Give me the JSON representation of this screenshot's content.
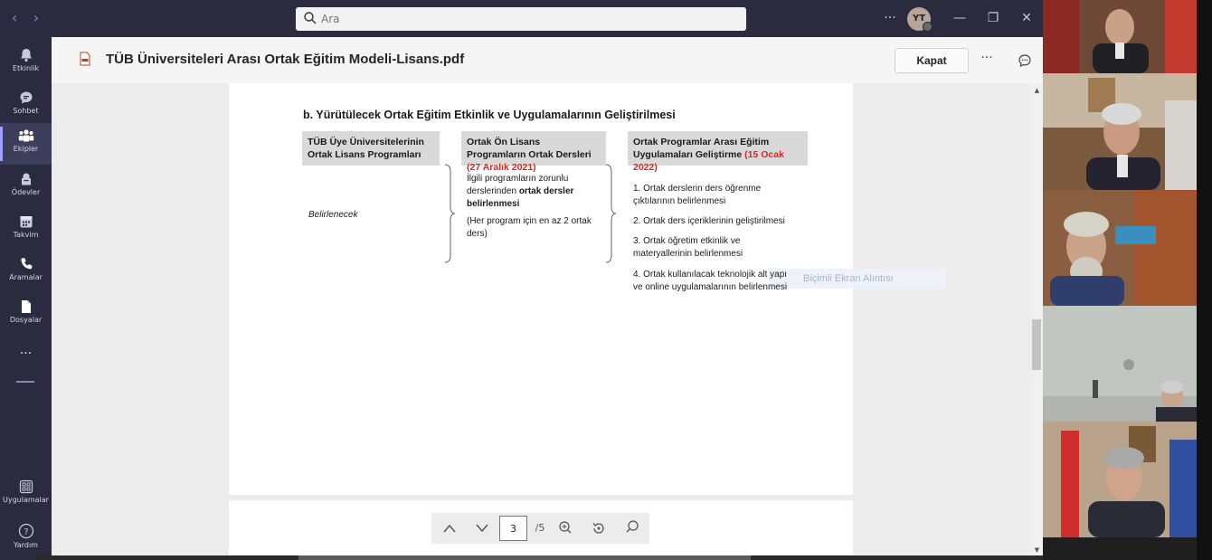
{
  "search": {
    "placeholder": "Ara"
  },
  "user": {
    "initials": "YT"
  },
  "window": {
    "more": "···",
    "minimize": "—",
    "restore": "❐",
    "close": "✕"
  },
  "nav": {
    "back": "‹",
    "forward": "›"
  },
  "rail": {
    "items": [
      {
        "label": "Etkinlik",
        "icon": "bell-icon"
      },
      {
        "label": "Sohbet",
        "icon": "chat-icon"
      },
      {
        "label": "Ekipler",
        "icon": "teams-icon"
      },
      {
        "label": "Ödevler",
        "icon": "assignments-icon"
      },
      {
        "label": "Takvim",
        "icon": "calendar-icon"
      },
      {
        "label": "Aramalar",
        "icon": "phone-icon"
      },
      {
        "label": "Dosyalar",
        "icon": "file-icon"
      }
    ],
    "more": "···",
    "apps": "Uygulamalar",
    "help": "Yardım"
  },
  "document": {
    "title": "TÜB Üniversiteleri Arası Ortak Eğitim Modeli-Lisans.pdf",
    "close_label": "Kapat",
    "more": "···"
  },
  "pdf": {
    "section_title": "b. Yürütülecek Ortak Eğitim Etkinlik ve Uygulamalarının Geliştirilmesi",
    "col1": {
      "header": "TÜB Üye Üniversitelerinin Ortak Lisans Programları",
      "body": "Belirlenecek"
    },
    "col2": {
      "header": "Ortak Ön Lisans Programların Ortak Dersleri",
      "header_date": "(27 Aralık 2021)",
      "body_prefix": "İlgili programların zorunlu derslerinden",
      "body_bold": "ortak dersler belirlenmesi",
      "note": "(Her program için en az 2 ortak ders)"
    },
    "col3": {
      "header": "Ortak Programlar Arası Eğitim Uygulamaları Geliştirme",
      "header_date": "(15 Ocak 2022)",
      "items": [
        "1. Ortak derslerin ders öğrenme çıktılarının belirlenmesi",
        "2. Ortak ders içeriklerinin geliştirilmesi",
        "3. Ortak öğretim etkinlik ve materyallerinin belirlenmesi",
        "4. Ortak kullanılacak teknolojik alt yapı ve online uygulamalarının belirlenmesi"
      ]
    }
  },
  "tooltip": "Biçimli Ekran Alıntısı",
  "page_controls": {
    "current": "3",
    "total": "/5"
  },
  "colors": {
    "accent": "#9ea2ff",
    "rail_bg": "#2b2b40",
    "header_red": "#e0251b",
    "table_header": "#d9d9d9"
  }
}
